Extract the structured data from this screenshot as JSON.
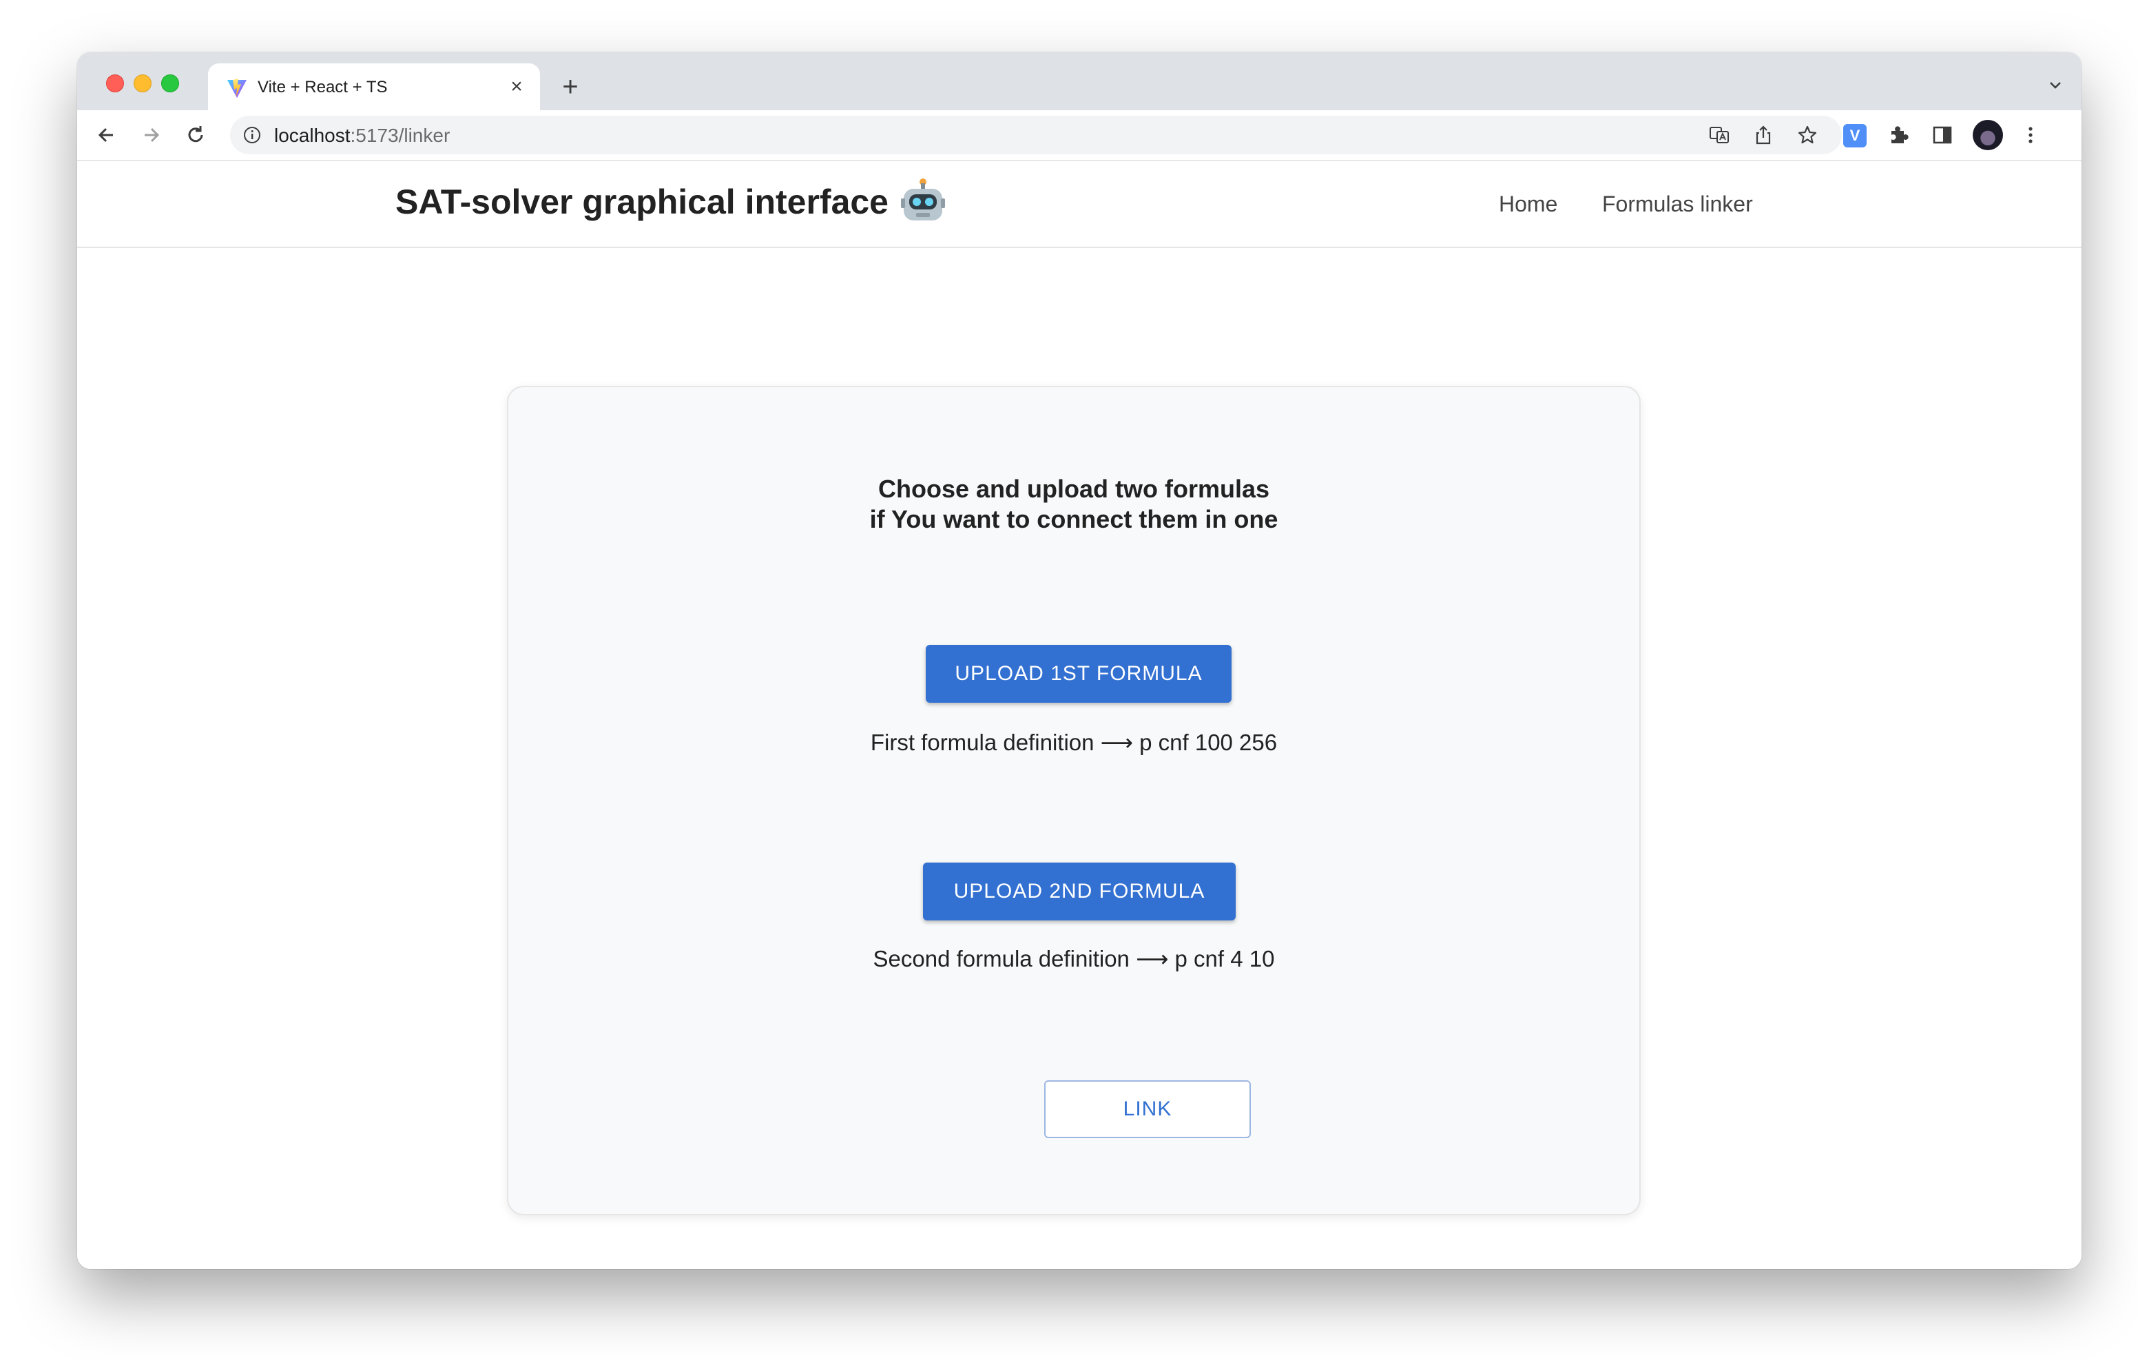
{
  "browser": {
    "tab_title": "Vite + React + TS",
    "url_host": "localhost",
    "url_path": ":5173/linker",
    "ext_label": "V"
  },
  "app": {
    "title": "SAT-solver graphical interface",
    "nav": {
      "home": "Home",
      "linker": "Formulas linker"
    }
  },
  "card": {
    "heading_line1": "Choose and upload two formulas",
    "heading_line2": "if You want to connect them in one",
    "upload1_label": "UPLOAD 1ST FORMULA",
    "definition1": "First formula definition ⟶ p cnf 100 256",
    "upload2_label": "UPLOAD 2ND FORMULA",
    "definition2": "Second formula definition ⟶ p cnf 4 10",
    "link_label": "LINK"
  },
  "colors": {
    "primary": "#3270d1",
    "card_bg": "#f8f9fa"
  },
  "icons": [
    "vite-favicon",
    "close-icon",
    "plus-icon",
    "chevron-down-icon",
    "back-icon",
    "forward-icon",
    "reload-icon",
    "info-icon",
    "translate-icon",
    "share-icon",
    "star-icon",
    "puzzle-icon",
    "sidebar-icon",
    "menu-dots-icon",
    "robot-icon"
  ]
}
